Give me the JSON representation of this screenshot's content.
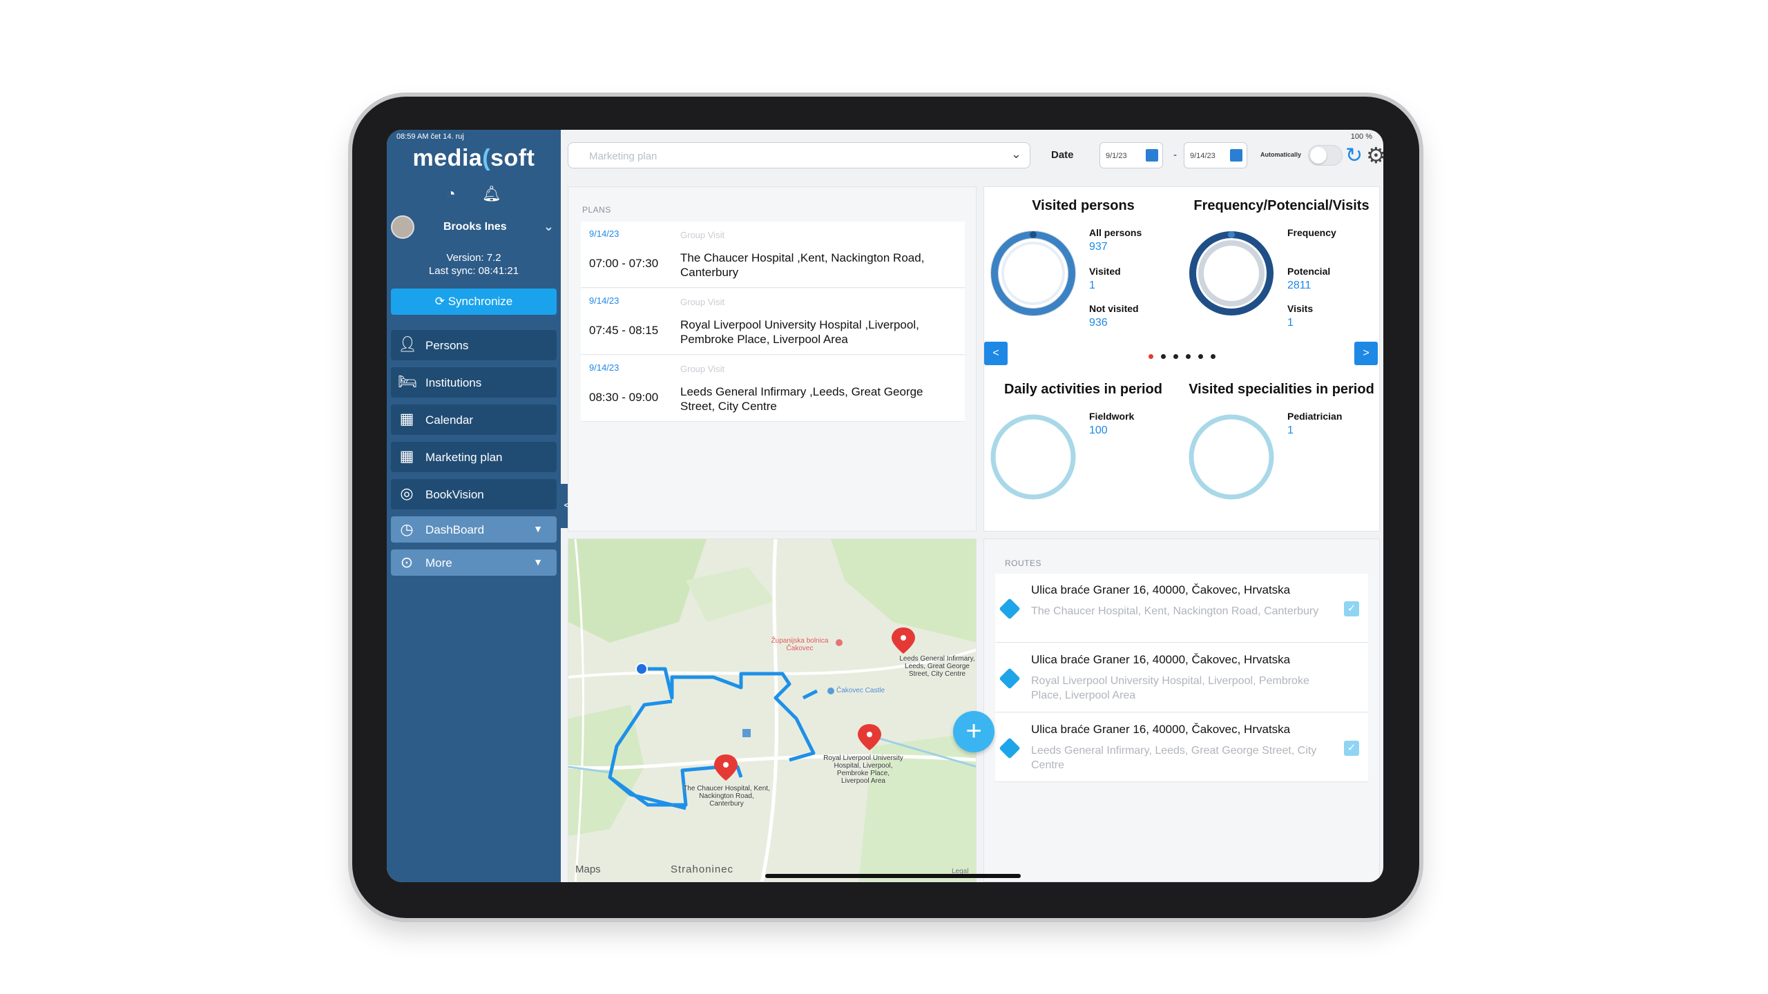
{
  "status": {
    "time": "08:59 AM  čet 14. ruj",
    "battery": "100 %"
  },
  "sidebar": {
    "logo_left": "media",
    "logo_x": "(",
    "logo_right": "soft",
    "user_name": "Brooks Ines",
    "version": "Version: 7.2",
    "last_sync": "Last sync: 08:41:21",
    "sync_label": "Synchronize",
    "items": [
      {
        "label": "Persons",
        "icon": "person-icon"
      },
      {
        "label": "Institutions",
        "icon": "bed-icon"
      },
      {
        "label": "Calendar",
        "icon": "calendar-icon"
      },
      {
        "label": "Marketing plan",
        "icon": "calendar-plus-icon"
      },
      {
        "label": "BookVision",
        "icon": "fingerprint-icon"
      },
      {
        "label": "DashBoard",
        "icon": "chart-icon"
      },
      {
        "label": "More",
        "icon": "more-icon"
      }
    ]
  },
  "topbar": {
    "plan_placeholder": "Marketing plan",
    "date_label": "Date",
    "date_from": "9/1/23",
    "date_to": "9/14/23",
    "auto_label": "Automatically"
  },
  "plans": {
    "title": "PLANS",
    "items": [
      {
        "date": "9/14/23",
        "type": "Group Visit",
        "time": "07:00 - 07:30",
        "place": "The Chaucer Hospital ,Kent, Nackington Road, Canterbury"
      },
      {
        "date": "9/14/23",
        "type": "Group Visit",
        "time": "07:45 - 08:15",
        "place": "Royal Liverpool University Hospital ,Liverpool, Pembroke Place, Liverpool Area"
      },
      {
        "date": "9/14/23",
        "type": "Group Visit",
        "time": "08:30 - 09:00",
        "place": "Leeds General Infirmary ,Leeds, Great George Street, City Centre"
      }
    ]
  },
  "stats": {
    "visited": {
      "title": "Visited persons",
      "all_label": "All persons",
      "all_value": "937",
      "visited_label": "Visited",
      "visited_value": "1",
      "not_label": "Not visited",
      "not_value": "936"
    },
    "frequency": {
      "title": "Frequency/Potencial/Visits",
      "freq_label": "Frequency",
      "pot_label": "Potencial",
      "pot_value": "2811",
      "visits_label": "Visits",
      "visits_value": "1"
    },
    "daily": {
      "title": "Daily activities in period",
      "label": "Fieldwork",
      "value": "100"
    },
    "specialities": {
      "title": "Visited specialities in period",
      "label": "Pediatrician",
      "value": "1"
    },
    "prev": "<",
    "next": ">",
    "page_count": 6,
    "active_page": 0
  },
  "map": {
    "credit": "Maps",
    "town": "Strahoninec",
    "legal": "Legal",
    "labels": {
      "leeds": "Leeds General Infirmary, Leeds, Great George Street, City Centre",
      "liverpool": "Royal Liverpool University Hospital, Liverpool, Pembroke Place, Liverpool Area",
      "chaucer": "The Chaucer Hospital, Kent, Nackington Road, Canterbury",
      "castle": "Čakovec Castle",
      "zupanijska": "Županijska bolnica Čakovec"
    }
  },
  "routes": {
    "title": "ROUTES",
    "items": [
      {
        "from": "Ulica braće Graner 16, 40000, Čakovec, Hrvatska",
        "to": "The Chaucer Hospital, Kent, Nackington Road, Canterbury"
      },
      {
        "from": "Ulica braće Graner 16, 40000, Čakovec, Hrvatska",
        "to": "Royal Liverpool University Hospital, Liverpool, Pembroke Place, Liverpool Area"
      },
      {
        "from": "Ulica braće Graner 16, 40000, Čakovec, Hrvatska",
        "to": "Leeds General Infirmary, Leeds, Great George Street, City Centre"
      }
    ]
  },
  "colors": {
    "sidebar": "#2e5c88",
    "accent": "#1e88e5",
    "sync": "#1aa3ec",
    "route": "#1e90e8"
  }
}
